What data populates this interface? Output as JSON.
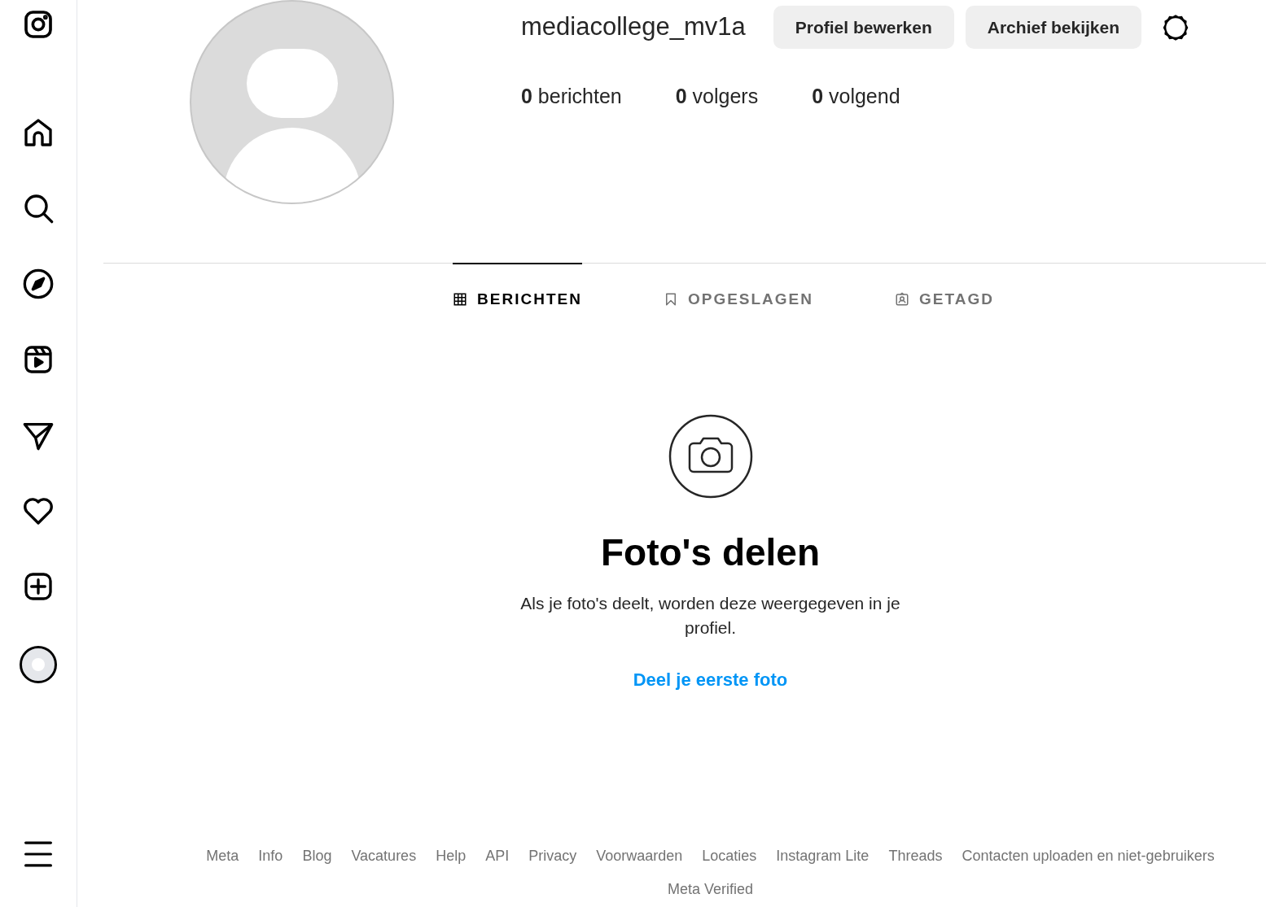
{
  "profile": {
    "username": "mediacollege_mv1a",
    "buttons": [
      "Profiel bewerken",
      "Archief bekijken"
    ],
    "stats": [
      {
        "count": "0",
        "label": "berichten"
      },
      {
        "count": "0",
        "label": "volgers"
      },
      {
        "count": "0",
        "label": "volgend"
      }
    ]
  },
  "tabs": [
    {
      "kind": "grid",
      "label": "BERICHTEN",
      "selected": true
    },
    {
      "kind": "bookmark",
      "label": "OPGESLAGEN",
      "selected": false
    },
    {
      "kind": "tagged",
      "label": "GETAGD",
      "selected": false
    }
  ],
  "empty_state": {
    "title": "Foto's delen",
    "text": "Als je foto's deelt, worden deze weergegeven in je profiel.",
    "link": "Deel je eerste foto"
  },
  "footer": {
    "links": [
      "Meta",
      "Info",
      "Blog",
      "Vacatures",
      "Help",
      "API",
      "Privacy",
      "Voorwaarden",
      "Locaties",
      "Instagram Lite",
      "Threads",
      "Contacten uploaden en niet-gebruikers",
      "Meta Verified"
    ]
  }
}
